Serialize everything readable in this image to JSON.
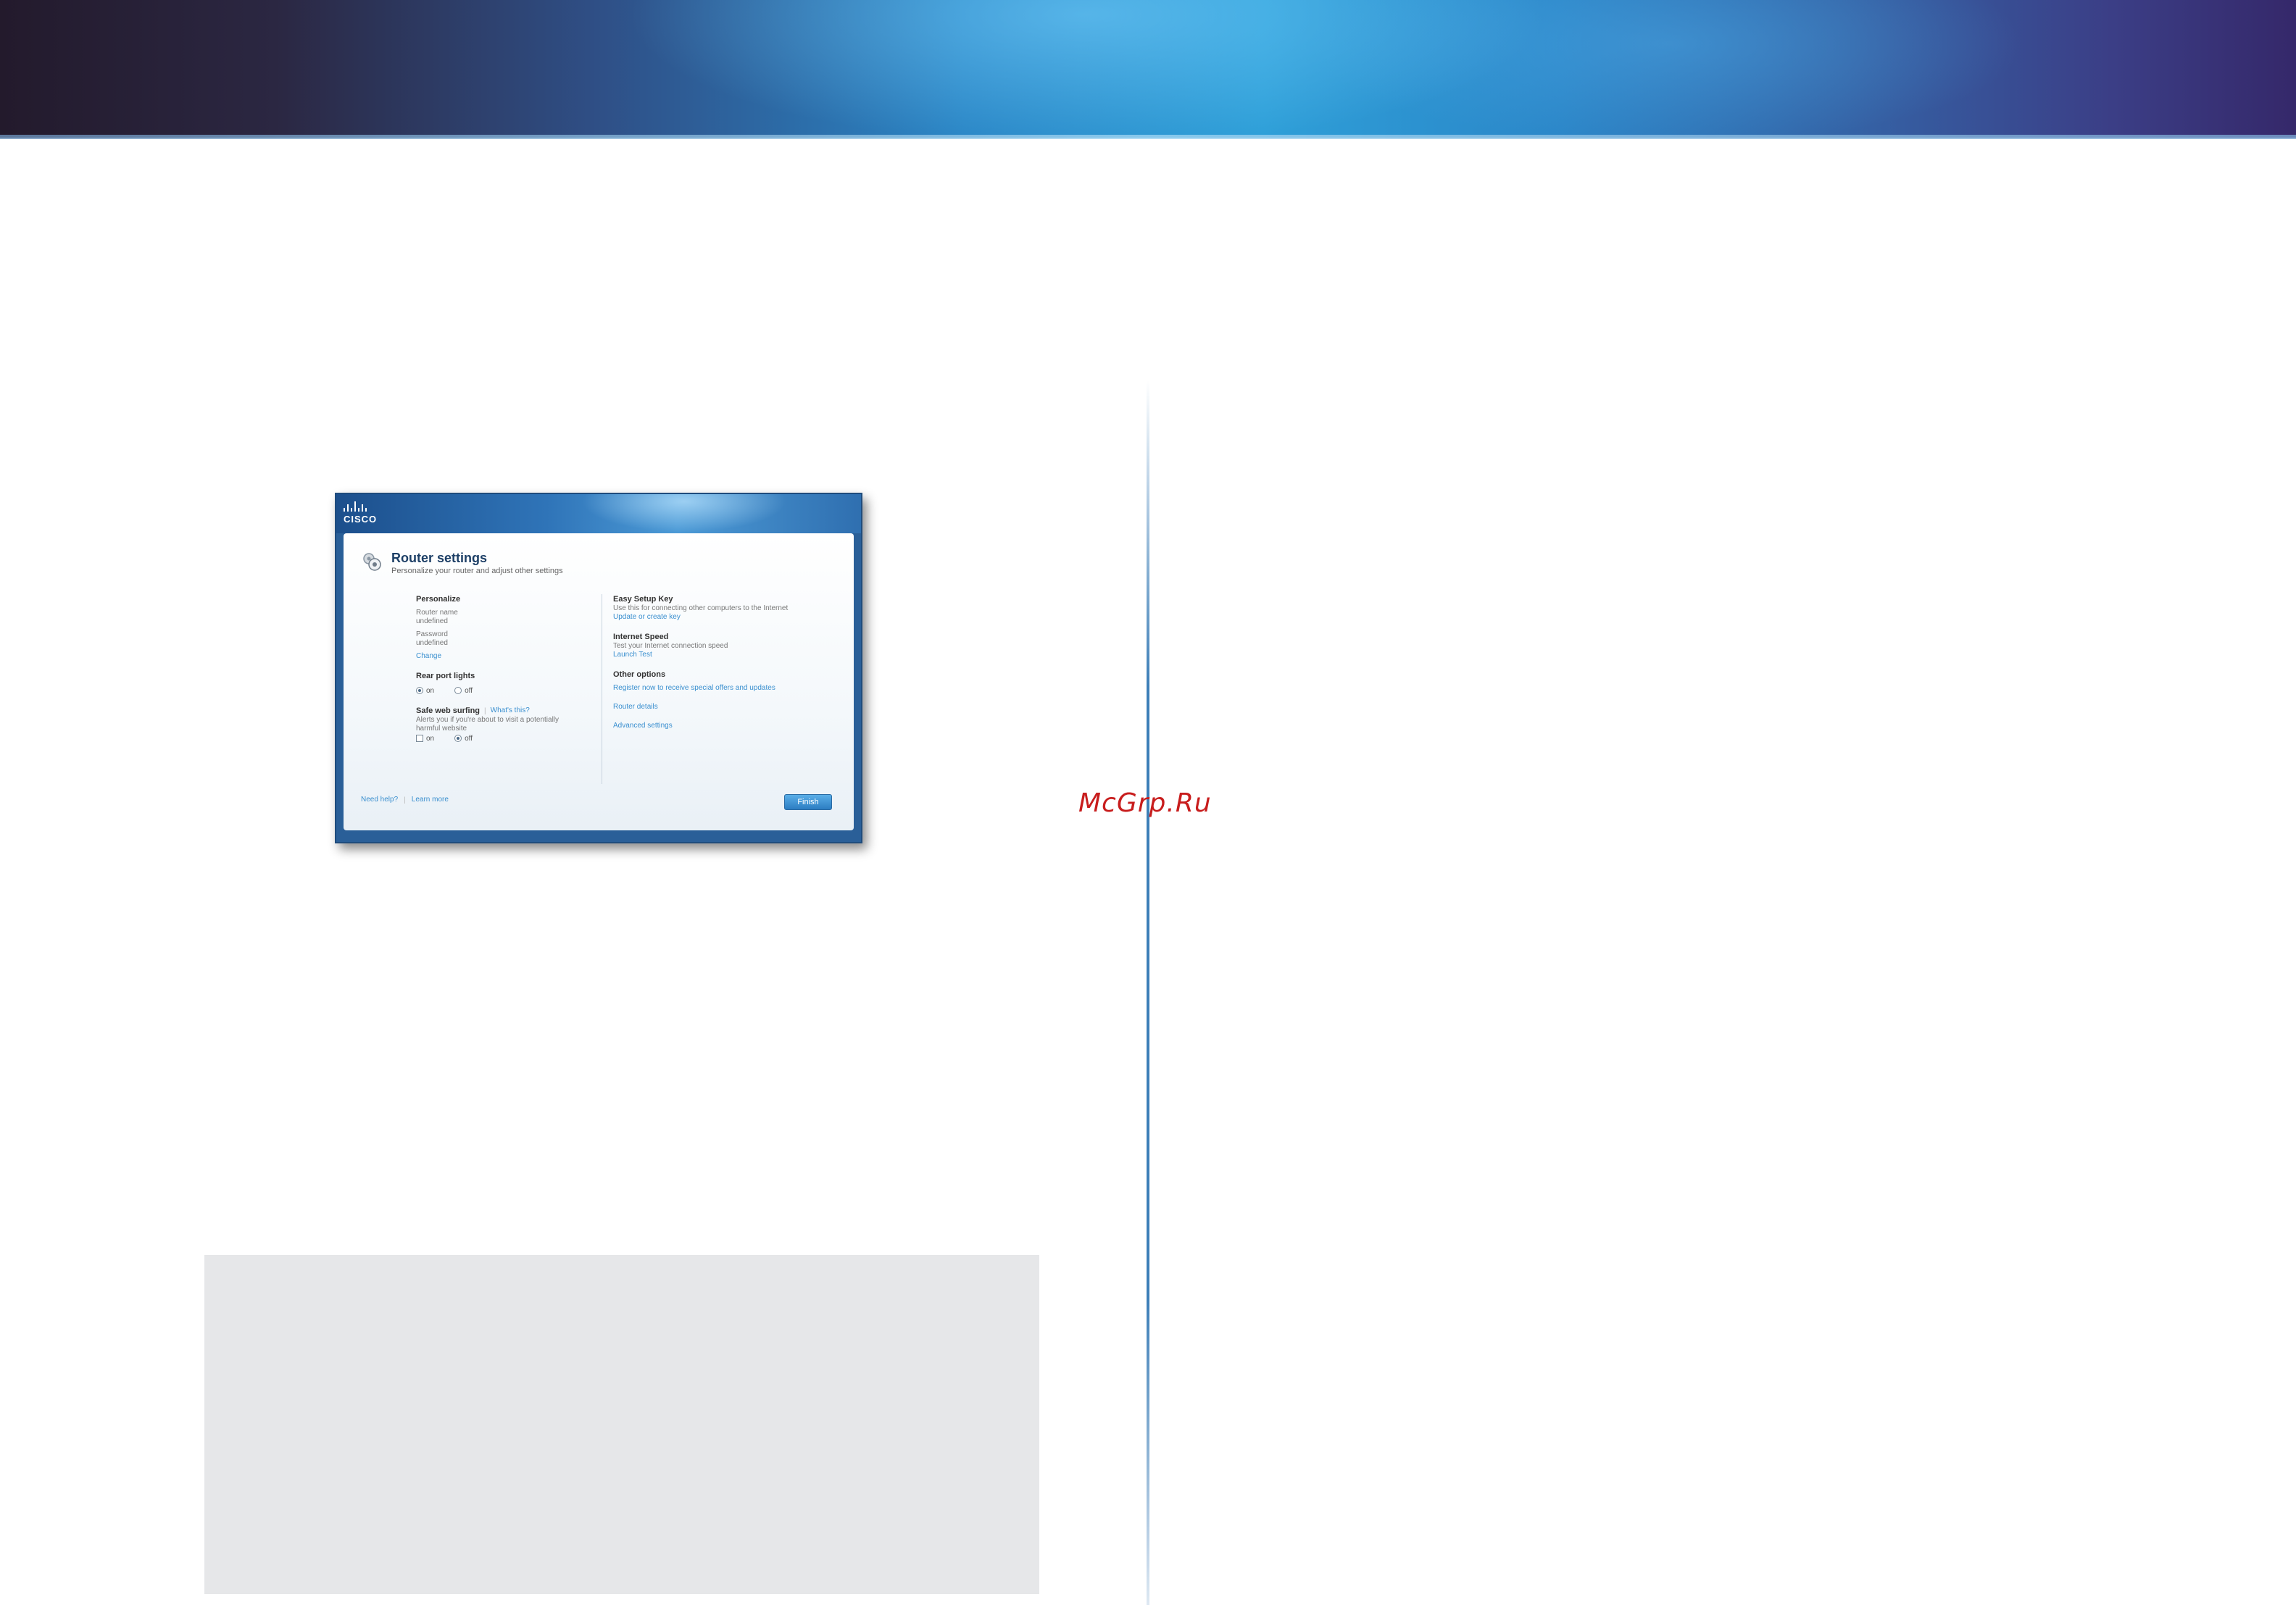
{
  "watermark": "McGrp.Ru",
  "router_window": {
    "brand": "CISCO",
    "title": "Router settings",
    "subtitle": "Personalize your router and adjust other settings",
    "left": {
      "personalize": {
        "heading": "Personalize",
        "router_name_label": "Router name",
        "router_name_value": "undefined",
        "password_label": "Password",
        "password_value": "undefined",
        "change_link": "Change"
      },
      "rear_port_lights": {
        "heading": "Rear port lights",
        "on_label": "on",
        "off_label": "off",
        "selected": "on"
      },
      "safe_web_surfing": {
        "heading": "Safe web surfing",
        "whats_this_link": "What's this?",
        "description_line1": "Alerts you if you're about to visit a potentially",
        "description_line2": "harmful website",
        "on_label": "on",
        "off_label": "off",
        "selected": "off"
      }
    },
    "right": {
      "easy_setup_key": {
        "heading": "Easy Setup Key",
        "description": "Use this for connecting other computers to the Internet",
        "link": "Update or create key"
      },
      "internet_speed": {
        "heading": "Internet Speed",
        "description": "Test your Internet connection speed",
        "link": "Launch Test"
      },
      "other_options": {
        "heading": "Other options",
        "register_link": "Register now to receive special offers and updates",
        "router_details_link": "Router details",
        "advanced_settings_link": "Advanced settings"
      }
    },
    "footer": {
      "need_help": "Need help?",
      "learn_more": "Learn more",
      "finish_button": "Finish"
    }
  }
}
